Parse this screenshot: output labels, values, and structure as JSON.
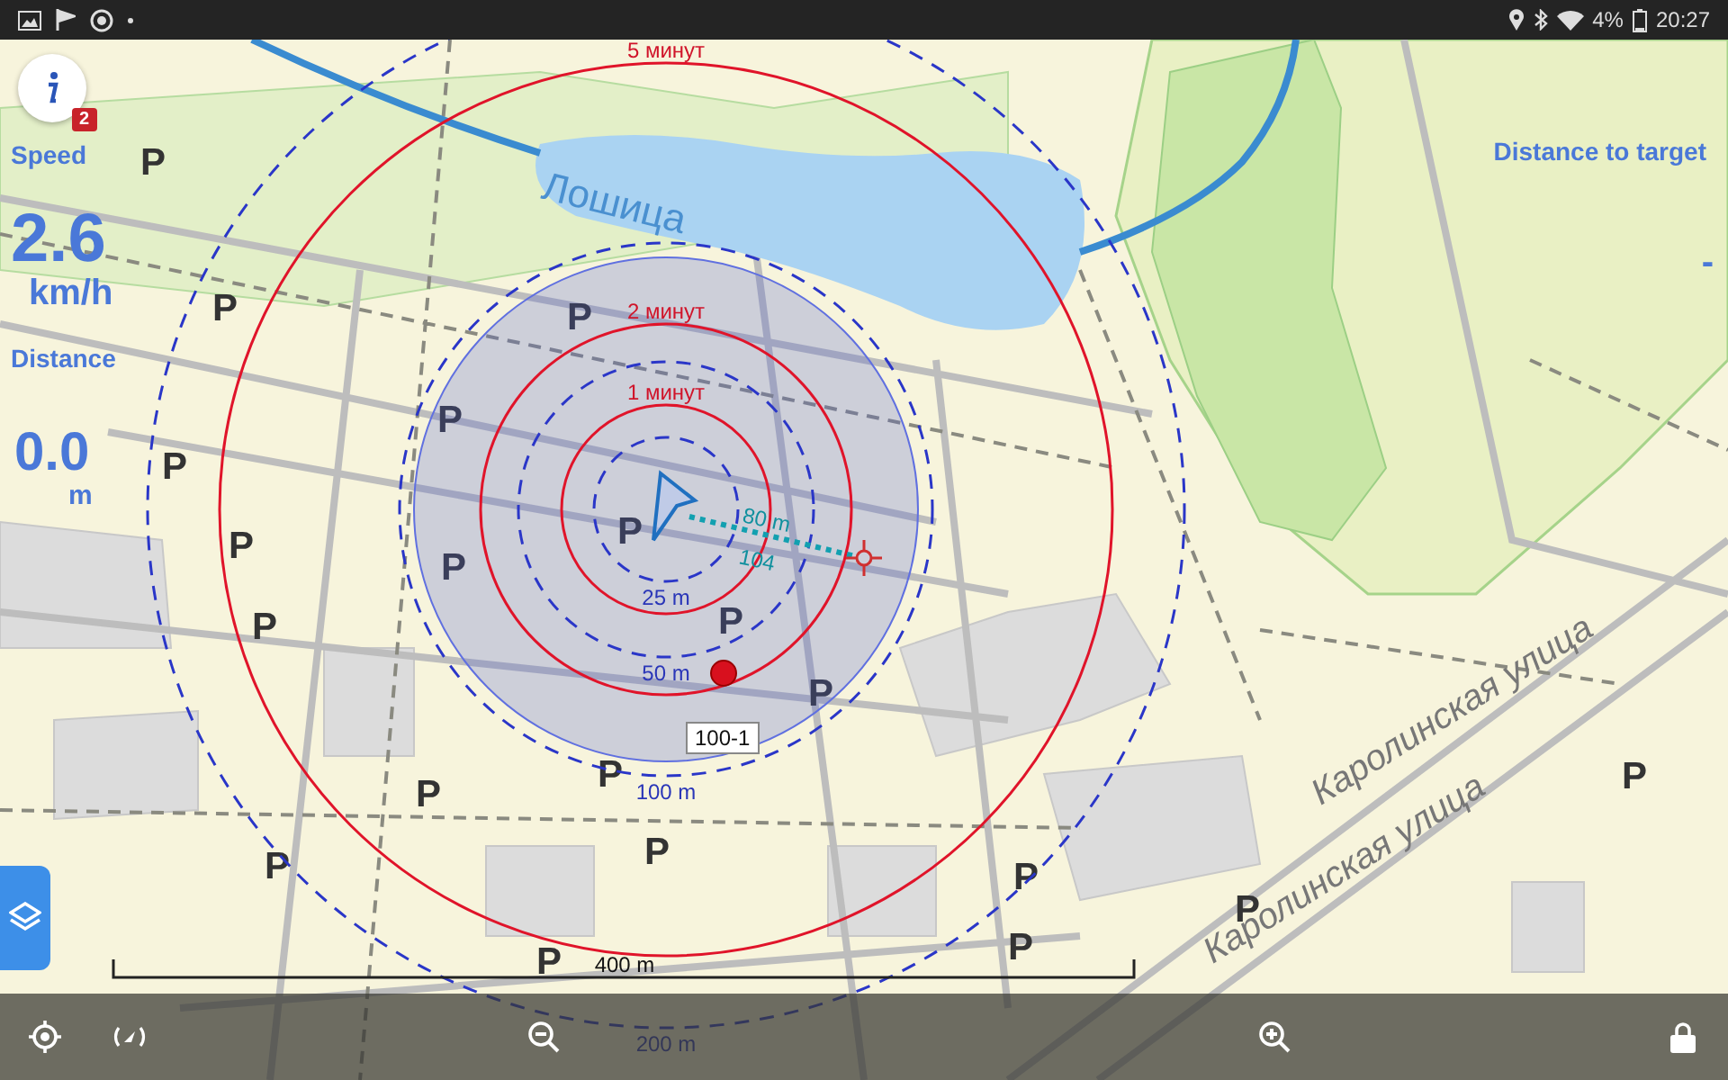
{
  "status_bar": {
    "battery": "4%",
    "time": "20:27"
  },
  "info_button": {
    "badge": "2"
  },
  "speed": {
    "label": "Speed",
    "value": "2.6",
    "unit": "km/h"
  },
  "distance": {
    "label": "Distance",
    "value": "0.0",
    "unit": "m"
  },
  "distance_to_target": {
    "label": "Distance to target",
    "value": "-"
  },
  "map": {
    "water_name": "Лошица",
    "street_names": [
      "Каролинская улица",
      "Каролинская улица"
    ],
    "parking_signs": [
      "P",
      "P",
      "P",
      "P",
      "P",
      "P",
      "P",
      "P",
      "P",
      "P",
      "P",
      "P",
      "P",
      "P",
      "P",
      "P",
      "P",
      "P",
      "P",
      "P"
    ],
    "rings": [
      {
        "kind": "time",
        "label": "5 минут"
      },
      {
        "kind": "time",
        "label": "2 минут"
      },
      {
        "kind": "time",
        "label": "1 минут"
      },
      {
        "kind": "distance",
        "label": "25 m"
      },
      {
        "kind": "distance",
        "label": "50 m"
      },
      {
        "kind": "distance",
        "label": "100 m"
      },
      {
        "kind": "distance",
        "label": "200 m"
      }
    ],
    "target_line": {
      "distance": "80 m",
      "bearing": "104"
    },
    "waypoint": {
      "label": "100-1"
    },
    "scale_bar": {
      "label": "400 m"
    }
  }
}
